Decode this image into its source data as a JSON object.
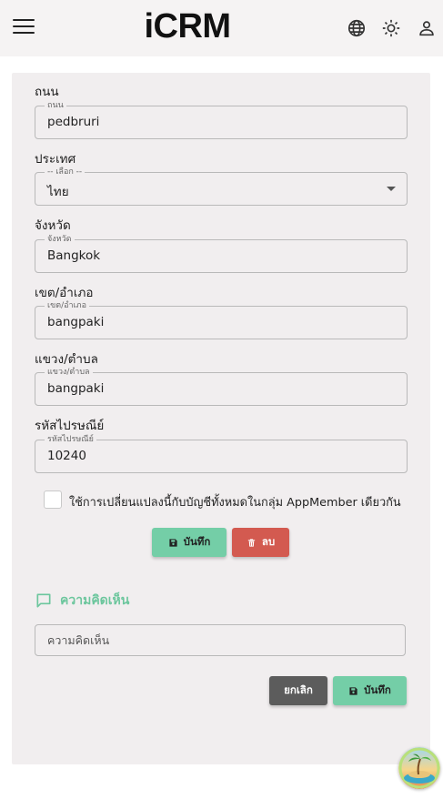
{
  "header": {
    "title": "iCRM",
    "menu_icon": "hamburger-menu-icon",
    "icons": [
      "globe-icon",
      "sun-icon",
      "user-icon"
    ]
  },
  "form": {
    "fields": [
      {
        "label": "ถนน",
        "legend": "ถนน",
        "value": "pedbruri",
        "type": "text"
      },
      {
        "label": "ประเทศ",
        "legend": "-- เลือก --",
        "value": "ไทย",
        "type": "select"
      },
      {
        "label": "จังหวัด",
        "legend": "จังหวัด",
        "value": "Bangkok",
        "type": "text"
      },
      {
        "label": "เขต/อำเภอ",
        "legend": "เขต/อำเภอ",
        "value": "bangpaki",
        "type": "text"
      },
      {
        "label": "แขวง/ตำบล",
        "legend": "แขวง/ตำบล",
        "value": "bangpaki",
        "type": "text"
      },
      {
        "label": "รหัสไปรษณีย์",
        "legend": "รหัสไปรษณีย์",
        "value": "10240",
        "type": "text"
      }
    ],
    "apply_all_label": "ใช้การเปลี่ยนแปลงนี้กับบัญชีทั้งหมดในกลุ่ม AppMember เดียวกัน",
    "apply_all_checked": false,
    "save_label": "บันทึก",
    "delete_label": "ลบ"
  },
  "comment": {
    "title": "ความคิดเห็น",
    "placeholder": "ความคิดเห็น",
    "cancel_label": "ยกเลิก",
    "save_label": "บันทึก"
  },
  "colors": {
    "accent": "#74cea7",
    "danger": "#d35a50",
    "neutral": "#5c5c5c",
    "card_bg": "#f1eeef"
  }
}
